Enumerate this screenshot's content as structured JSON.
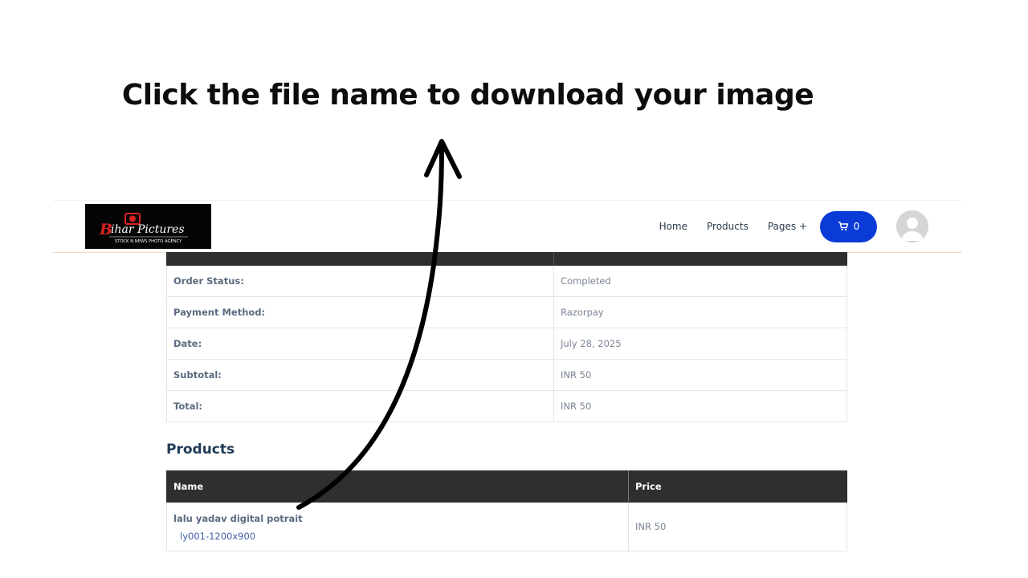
{
  "headline": "Click the file name to download your image",
  "header": {
    "logo_title": "Bihar Pictures",
    "logo_tagline": "STOCK N NEWS PHOTO AGENCY",
    "nav": [
      {
        "label": "Home"
      },
      {
        "label": "Products"
      },
      {
        "label": "Pages +"
      }
    ],
    "cart_count": "0",
    "cart_color": "#0a3bd6"
  },
  "order": {
    "rows": [
      {
        "label": "Order Status:",
        "value": "Completed"
      },
      {
        "label": "Payment Method:",
        "value": "Razorpay"
      },
      {
        "label": "Date:",
        "value": "July 28, 2025"
      },
      {
        "label": "Subtotal:",
        "value": "INR 50"
      },
      {
        "label": "Total:",
        "value": "INR 50"
      }
    ]
  },
  "products": {
    "title": "Products",
    "headers": {
      "name": "Name",
      "price": "Price"
    },
    "items": [
      {
        "name": "lalu yadav digital potrait",
        "file": "ly001-1200x900",
        "price": "INR 50"
      }
    ]
  },
  "icons": {
    "cart": "cart-icon",
    "avatar": "user-avatar-icon",
    "arrow": "curved-arrow-icon"
  }
}
